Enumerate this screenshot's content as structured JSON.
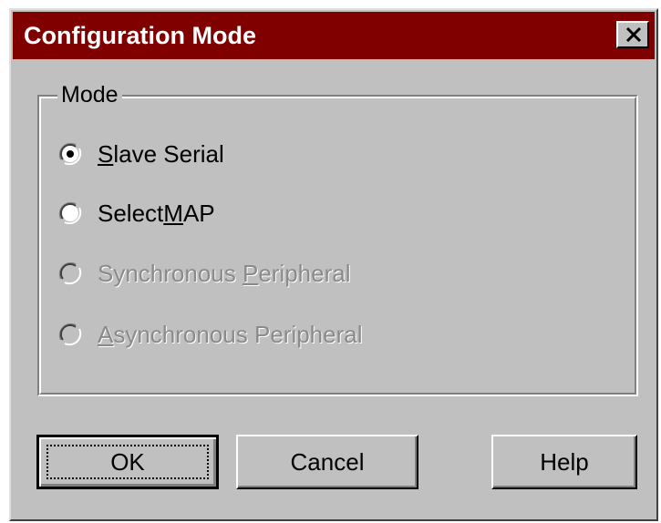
{
  "window": {
    "title": "Configuration Mode",
    "close_icon": "close-x-icon"
  },
  "mode_group": {
    "label": "Mode",
    "options": [
      {
        "pre": "",
        "accel": "S",
        "post": "lave Serial",
        "selected": true,
        "enabled": true
      },
      {
        "pre": "Select",
        "accel": "M",
        "post": "AP",
        "selected": false,
        "enabled": true
      },
      {
        "pre": "Synchronous ",
        "accel": "P",
        "post": "eripheral",
        "selected": false,
        "enabled": false
      },
      {
        "pre": "",
        "accel": "A",
        "post": "synchronous Peripheral",
        "selected": false,
        "enabled": false
      }
    ]
  },
  "buttons": {
    "ok": "OK",
    "cancel": "Cancel",
    "help": "Help"
  },
  "colors": {
    "titlebar": "#800000",
    "face": "#c0c0c0",
    "disabled_text": "#8a8a8a"
  }
}
